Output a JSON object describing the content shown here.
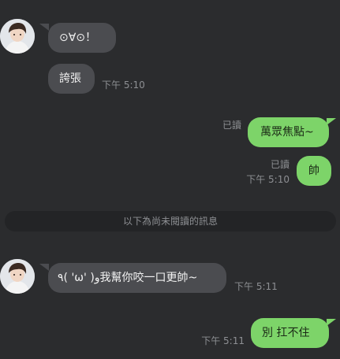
{
  "messages": [
    {
      "id": "m1",
      "direction": "incoming",
      "text": "⊙∀⊙！"
    },
    {
      "id": "m2",
      "direction": "incoming",
      "text": "誇張",
      "time": "下午 5:10"
    },
    {
      "id": "m3",
      "direction": "outgoing",
      "text": "萬眾焦點~",
      "read": "已讀"
    },
    {
      "id": "m4",
      "direction": "outgoing",
      "text": "帥",
      "read": "已讀",
      "time": "下午 5:10"
    },
    {
      "id": "m5",
      "direction": "incoming",
      "text": "٩( 'ω' )و我幫你咬一口更帥~",
      "time": "下午 5:11"
    },
    {
      "id": "m6",
      "direction": "outgoing",
      "text": "別  扛不住",
      "time": "下午 5:11"
    }
  ],
  "unread_divider": "以下為尚未閱讀的訊息",
  "colors": {
    "background": "#2b2c2e",
    "incoming_bubble": "#4b4c50",
    "outgoing_bubble": "#7dd469",
    "meta_text": "#8d8f93"
  },
  "icons": {
    "avatar": "contact-avatar-photo"
  }
}
